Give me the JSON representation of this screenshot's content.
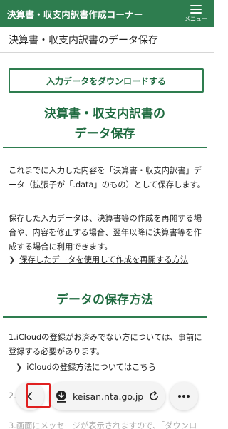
{
  "header": {
    "site_title": "決算書・収支内訳書作成コーナー",
    "menu_label": "メニュー"
  },
  "page": {
    "title": "決算書・収支内訳書のデータ保存"
  },
  "main": {
    "download_button": "入力データをダウンロードする",
    "heading_line1": "決算書・収支内訳書の",
    "heading_line2": "データ保存",
    "para1": "これまでに入力した内容を「決算書・収支内訳書」データ（拡張子が「.data」のもの）として保存します。",
    "para2": "保存した入力データは、決算書等の作成を再開する場合や、内容を修正する場合、翌年以降に決算書等を作成する場合に利用できます。",
    "link_resume": "保存したデータを使用して作成を再開する方法",
    "heading2": "データの保存方法",
    "list1": "1.iCloudの登録がお済みでない方については、事前に登録する必要があります。",
    "link_icloud": "iCloudの登録方法についてはこちら",
    "list2": "2.",
    "list3": "3.画面にメッセージが表示されますので、「ダウンロ"
  },
  "browser": {
    "url": "keisan.nta.go.jp"
  }
}
